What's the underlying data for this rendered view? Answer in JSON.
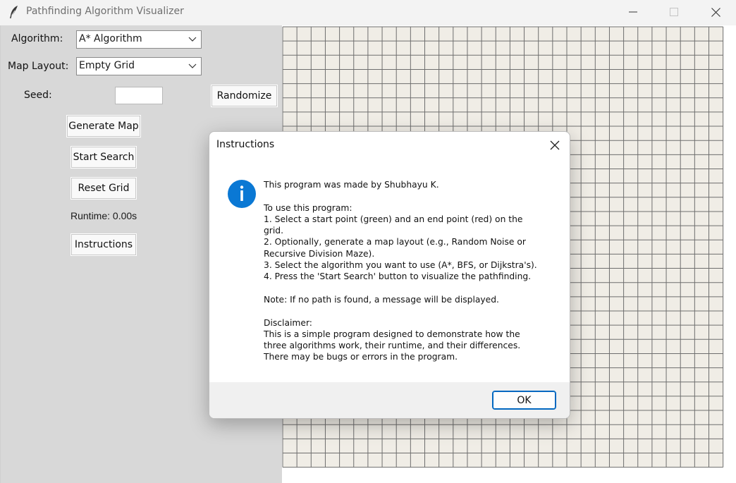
{
  "window": {
    "title": "Pathfinding Algorithm Visualizer",
    "icon": "feather-icon"
  },
  "controls": {
    "algorithm_label": "Algorithm:",
    "algorithm_value": "A* Algorithm",
    "layout_label": "Map Layout:",
    "layout_value": "Empty Grid",
    "seed_label": "Seed:",
    "seed_value": "",
    "randomize_label": "Randomize",
    "generate_label": "Generate Map",
    "start_label": "Start Search",
    "reset_label": "Reset Grid",
    "runtime_text": "Runtime: 0.00s",
    "instructions_label": "Instructions"
  },
  "grid": {
    "cell_color": "#f0ede6",
    "line_color": "#6e6e6e"
  },
  "dialog": {
    "title": "Instructions",
    "icon": "info-icon",
    "message": "This program was made by Shubhayu K.\n\nTo use this program:\n1. Select a start point (green) and an end point (red) on the\ngrid.\n2. Optionally, generate a map layout (e.g., Random Noise or\nRecursive Division Maze).\n3. Select the algorithm you want to use (A*, BFS, or Dijkstra's).\n4. Press the 'Start Search' button to visualize the pathfinding.\n\nNote: If no path is found, a message will be displayed.\n\nDisclaimer:\nThis is a simple program designed to demonstrate how the\nthree algorithms work, their runtime, and their differences.\nThere may be bugs or errors in the program.",
    "ok_label": "OK",
    "accent": "#0067c0"
  }
}
